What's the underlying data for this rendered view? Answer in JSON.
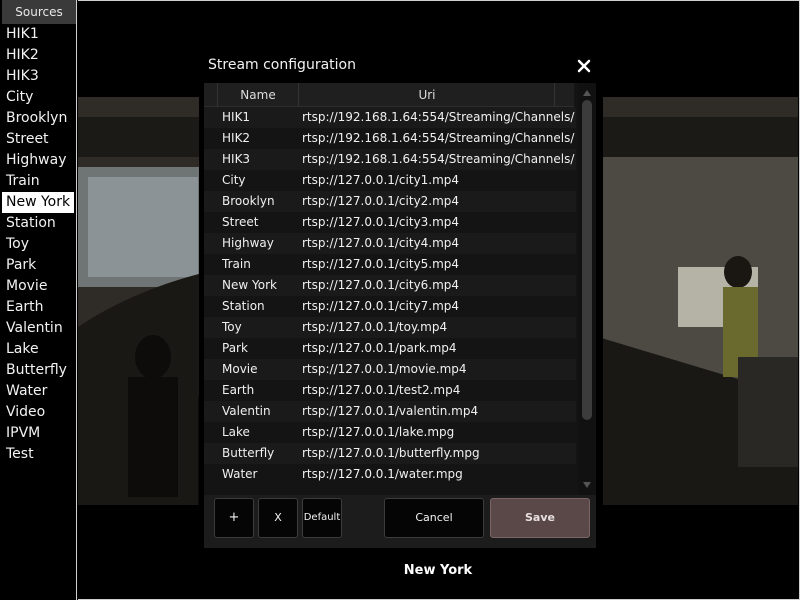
{
  "sidebar": {
    "header": "Sources",
    "items": [
      {
        "label": "HIK1"
      },
      {
        "label": "HIK2"
      },
      {
        "label": "HIK3"
      },
      {
        "label": "City"
      },
      {
        "label": "Brooklyn"
      },
      {
        "label": "Street"
      },
      {
        "label": "Highway"
      },
      {
        "label": "Train"
      },
      {
        "label": "New York",
        "selected": true
      },
      {
        "label": "Station"
      },
      {
        "label": "Toy"
      },
      {
        "label": "Park"
      },
      {
        "label": "Movie"
      },
      {
        "label": "Earth"
      },
      {
        "label": "Valentin"
      },
      {
        "label": "Lake"
      },
      {
        "label": "Butterfly"
      },
      {
        "label": "Water"
      },
      {
        "label": "Video"
      },
      {
        "label": "IPVM"
      },
      {
        "label": "Test"
      }
    ]
  },
  "video": {
    "caption": "New York"
  },
  "dialog": {
    "title": "Stream configuration",
    "close_icon": "close-icon",
    "columns": {
      "name": "Name",
      "uri": "Uri"
    },
    "rows": [
      {
        "name": "HIK1",
        "uri": "rtsp://192.168.1.64:554/Streaming/Channels/"
      },
      {
        "name": "HIK2",
        "uri": "rtsp://192.168.1.64:554/Streaming/Channels/"
      },
      {
        "name": "HIK3",
        "uri": "rtsp://192.168.1.64:554/Streaming/Channels/"
      },
      {
        "name": "City",
        "uri": "rtsp://127.0.0.1/city1.mp4"
      },
      {
        "name": "Brooklyn",
        "uri": "rtsp://127.0.0.1/city2.mp4"
      },
      {
        "name": "Street",
        "uri": "rtsp://127.0.0.1/city3.mp4"
      },
      {
        "name": "Highway",
        "uri": "rtsp://127.0.0.1/city4.mp4"
      },
      {
        "name": "Train",
        "uri": "rtsp://127.0.0.1/city5.mp4"
      },
      {
        "name": "New York",
        "uri": "rtsp://127.0.0.1/city6.mp4"
      },
      {
        "name": "Station",
        "uri": "rtsp://127.0.0.1/city7.mp4"
      },
      {
        "name": "Toy",
        "uri": "rtsp://127.0.0.1/toy.mp4"
      },
      {
        "name": "Park",
        "uri": "rtsp://127.0.0.1/park.mp4"
      },
      {
        "name": "Movie",
        "uri": "rtsp://127.0.0.1/movie.mp4"
      },
      {
        "name": "Earth",
        "uri": "rtsp://127.0.0.1/test2.mp4"
      },
      {
        "name": "Valentin",
        "uri": "rtsp://127.0.0.1/valentin.mp4"
      },
      {
        "name": "Lake",
        "uri": "rtsp://127.0.0.1/lake.mpg"
      },
      {
        "name": "Butterfly",
        "uri": "rtsp://127.0.0.1/butterfly.mpg"
      },
      {
        "name": "Water",
        "uri": "rtsp://127.0.0.1/water.mpg"
      }
    ],
    "buttons": {
      "add": "+",
      "remove": "X",
      "default": "Default",
      "cancel": "Cancel",
      "save": "Save"
    }
  },
  "colors": {
    "save_button_bg": "#5a4848",
    "selected_item_bg": "#ffffff"
  }
}
